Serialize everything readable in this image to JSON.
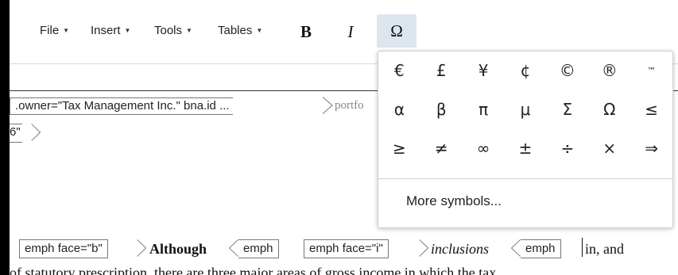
{
  "menu": {
    "file": "File",
    "insert": "Insert",
    "tools": "Tools",
    "tables": "Tables",
    "caret": "▼"
  },
  "format": {
    "bold": "B",
    "italic": "I",
    "special_char": "Ω"
  },
  "breadcrumb": {
    "tag_text": ".owner=\"Tax Management Inc.\" bna.id ...",
    "next_text": "portfo",
    "second_fragment": "6\""
  },
  "content": {
    "tag1": "emph face=\"b\"",
    "bold_word": "Although",
    "tag2": "emph",
    "tag3": "emph face=\"i\"",
    "italic_word": "inclusions",
    "tag4": "emph",
    "after_cursor": "in, and",
    "next_line": "of statutory prescription, there are three major areas of gross income in which the tax"
  },
  "symbol_popup": {
    "symbols": [
      "€",
      "£",
      "¥",
      "¢",
      "©",
      "®",
      "™",
      "α",
      "β",
      "π",
      "μ",
      "Σ",
      "Ω",
      "≤",
      "≥",
      "≠",
      "∞",
      "±",
      "÷",
      "×",
      "⇒"
    ],
    "more_label": "More symbols..."
  },
  "colors": {
    "active_button_bg": "#dde6ef",
    "page_bg": "#ffffff"
  }
}
